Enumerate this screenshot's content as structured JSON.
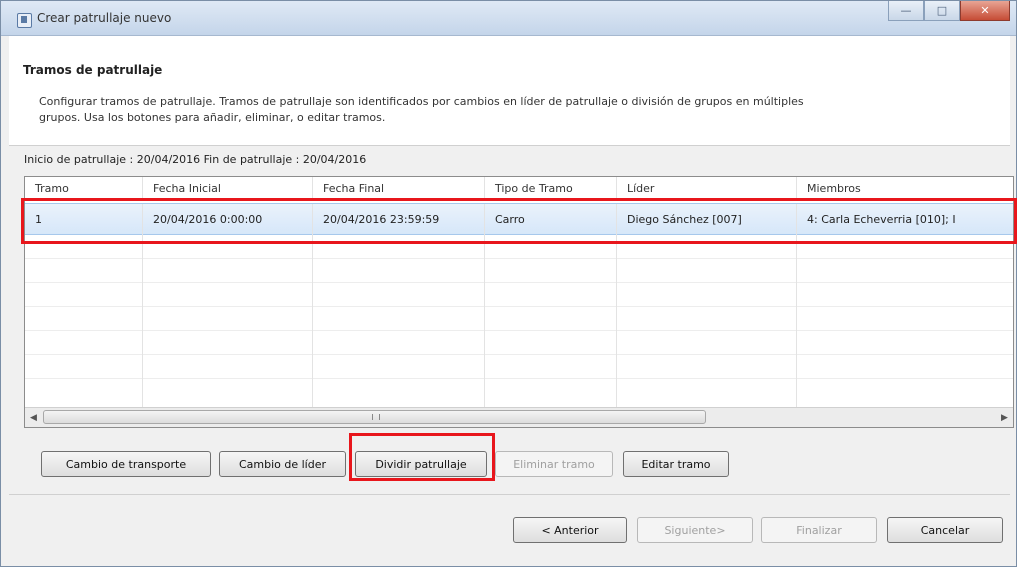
{
  "window": {
    "title": "Crear patrullaje nuevo"
  },
  "header": {
    "title": "Tramos de patrullaje",
    "description": "Configurar tramos de patrullaje. Tramos de patrullaje son identificados por cambios en líder de patrullaje o división de grupos en múltiples grupos. Usa los botones para añadir, eliminar, o editar tramos."
  },
  "period": {
    "text": "Inicio de patrullaje : 20/04/2016  Fin de patrullaje : 20/04/2016"
  },
  "table": {
    "columns": [
      "Tramo",
      "Fecha Inicial",
      "Fecha Final",
      "Tipo de Tramo",
      "Líder",
      "Miembros"
    ],
    "rows": [
      {
        "tramo": "1",
        "fecha_inicial": "20/04/2016 0:00:00",
        "fecha_final": "20/04/2016 23:59:59",
        "tipo": "Carro",
        "lider": "Diego Sánchez [007]",
        "miembros": "4: Carla Echeverria [010]; I"
      }
    ]
  },
  "actions": {
    "cambio_transporte": "Cambio de transporte",
    "cambio_lider": "Cambio de líder",
    "dividir": "Dividir patrullaje",
    "eliminar": "Eliminar tramo",
    "editar": "Editar tramo"
  },
  "nav": {
    "anterior": "< Anterior",
    "siguiente": "Siguiente>",
    "finalizar": "Finalizar",
    "cancelar": "Cancelar"
  },
  "colors": {
    "highlight": "#e8161c",
    "selection": "#d6e7f9"
  }
}
